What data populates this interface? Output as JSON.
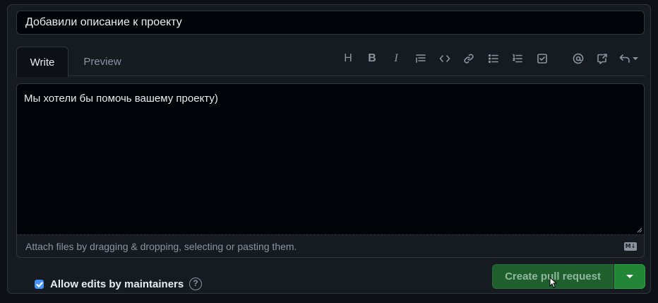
{
  "title_field": {
    "value": "Добавили описание к проекту"
  },
  "tabs": [
    {
      "label": "Write",
      "active": true
    },
    {
      "label": "Preview",
      "active": false
    }
  ],
  "toolbar": {
    "heading": "H",
    "bold": "B",
    "italic": "I",
    "icons": [
      "heading-icon",
      "bold-icon",
      "italic-icon",
      "quote-icon",
      "code-icon",
      "link-icon",
      "unordered-list-icon",
      "ordered-list-icon",
      "task-list-icon",
      "mention-icon",
      "cross-reference-icon",
      "undo-icon"
    ]
  },
  "editor": {
    "value": "Мы хотели бы помочь вашему проекту)"
  },
  "attach": {
    "hint": "Attach files by dragging & dropping, selecting or pasting them.",
    "markdown_badge": "M↓"
  },
  "allow_edits": {
    "label": "Allow edits by maintainers",
    "checked": true,
    "help": "?"
  },
  "submit": {
    "label": "Create pull request",
    "accent": "#238636"
  }
}
